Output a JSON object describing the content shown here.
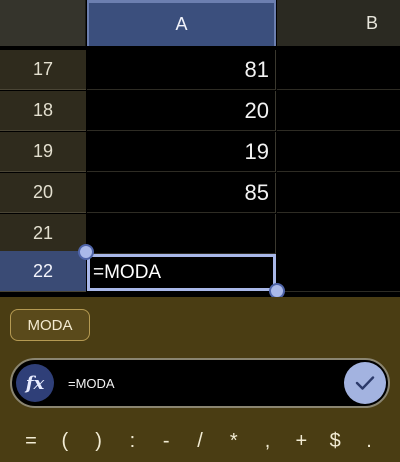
{
  "columns": {
    "a": "A",
    "b": "B"
  },
  "rows": [
    {
      "num": "17",
      "a": "81"
    },
    {
      "num": "18",
      "a": "20"
    },
    {
      "num": "19",
      "a": "19"
    },
    {
      "num": "20",
      "a": "85"
    },
    {
      "num": "21",
      "a": ""
    },
    {
      "num": "22",
      "a": "=MODA"
    }
  ],
  "suggestion": "MODA",
  "formula_bar": {
    "fx_label": "fx",
    "text": "=MODA"
  },
  "keys": [
    "=",
    "(",
    ")",
    ":",
    "-",
    "/",
    "*",
    ",",
    "+",
    "$",
    "."
  ]
}
